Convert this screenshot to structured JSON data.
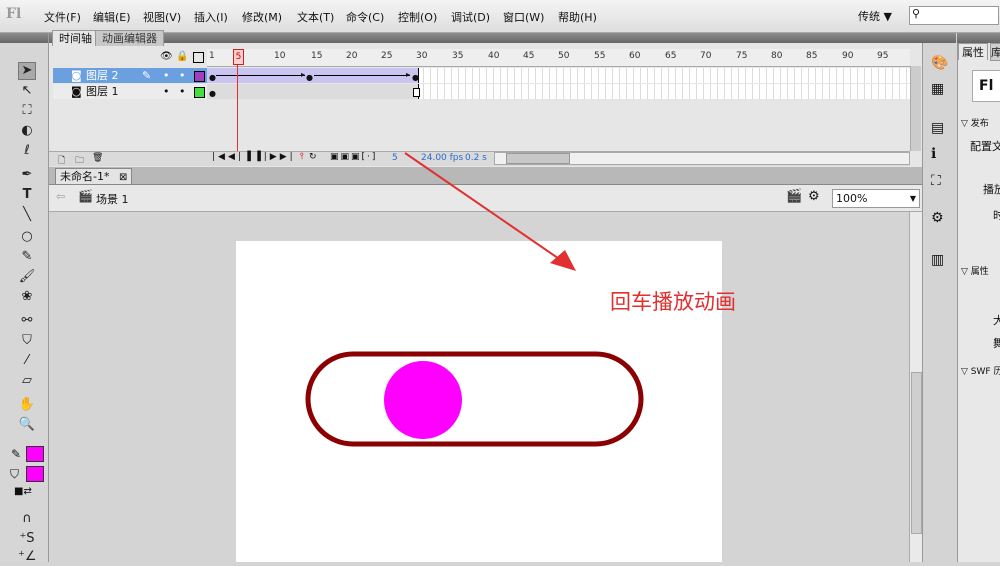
{
  "app": {
    "logo": "Fl"
  },
  "menu": [
    "文件(F)",
    "编辑(E)",
    "视图(V)",
    "插入(I)",
    "修改(M)",
    "文本(T)",
    "命令(C)",
    "控制(O)",
    "调试(D)",
    "窗口(W)",
    "帮助(H)"
  ],
  "workspace": "传统 ▼",
  "timeline": {
    "tabs": [
      "时间轴",
      "动画编辑器"
    ],
    "frame_labels": [
      "1",
      "5",
      "10",
      "15",
      "20",
      "25",
      "30",
      "35",
      "40",
      "45",
      "50",
      "55",
      "60",
      "65",
      "70",
      "75",
      "80",
      "85",
      "90",
      "95"
    ],
    "playhead_frame": "5",
    "layers": [
      {
        "name": "图层 2",
        "color": "#a040c0",
        "selected": true
      },
      {
        "name": "图层 1",
        "color": "#40e040",
        "selected": false
      }
    ],
    "footer": {
      "current_frame": "5",
      "fps": "24.00 fps",
      "time": "0.2 s"
    }
  },
  "document": {
    "tab": "未命名-1*",
    "close": "⊠",
    "scene": "场景 1",
    "zoom": "100%"
  },
  "stage_content": {
    "annotation": "回车播放动画",
    "pill_stroke": "#8b0000",
    "ball_color": "#ff00ff",
    "annotation_color": "#e03030"
  },
  "tools": {
    "stroke_color": "#ff00ff",
    "fill_color": "#ff00ff"
  },
  "properties": {
    "tabs": [
      "属性",
      "库"
    ],
    "app_abbr": "Fl",
    "sections": [
      "发布",
      "配置文",
      "播放",
      "时",
      "属性",
      "大",
      "舞",
      "SWF 历"
    ]
  }
}
